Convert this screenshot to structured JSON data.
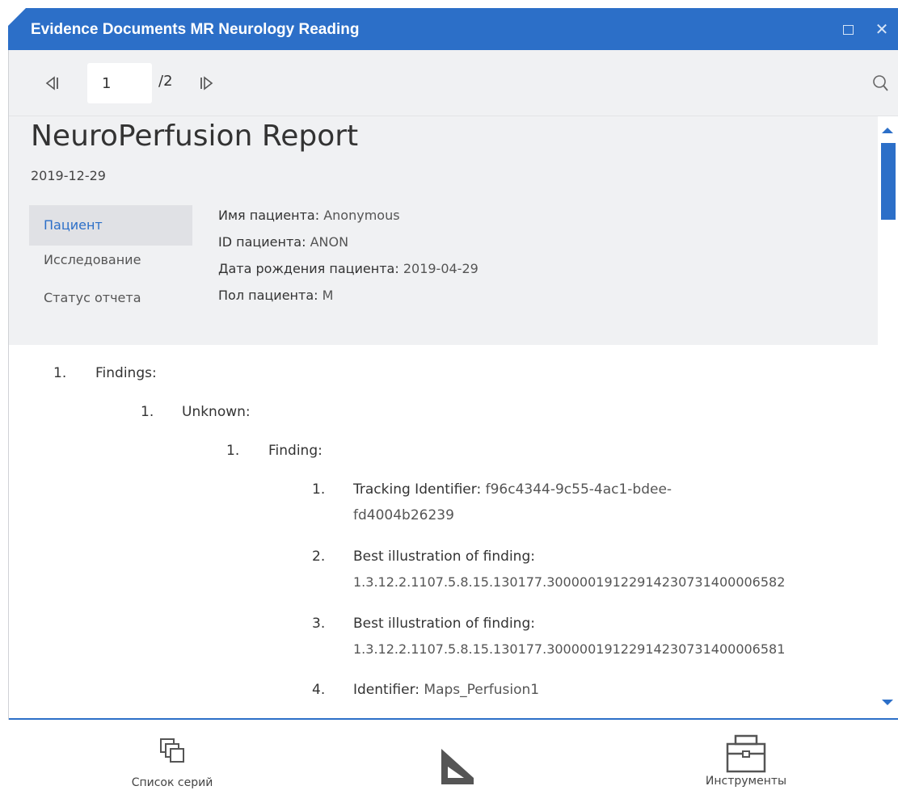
{
  "window": {
    "title": "Evidence Documents MR Neurology Reading"
  },
  "toolbar": {
    "current_page": "1",
    "total_pages": "/2"
  },
  "report": {
    "title": "NeuroPerfusion Report",
    "date": "2019-12-29"
  },
  "side_tabs": [
    {
      "label": "Пациент",
      "active": true
    },
    {
      "label": "Исследование",
      "active": false
    },
    {
      "label": "Статус отчета",
      "active": false
    }
  ],
  "patient": [
    {
      "key": "Имя пациента:",
      "value": "Anonymous"
    },
    {
      "key": "ID пациента:",
      "value": "ANON"
    },
    {
      "key": "Дата рождения пациента:",
      "value": "2019-04-29"
    },
    {
      "key": "Пол пациента:",
      "value": "M"
    }
  ],
  "findings": {
    "l1_num": "1.",
    "l1_label": "Findings:",
    "l2_num": "1.",
    "l2_label": "Unknown:",
    "l3_num": "1.",
    "l3_label": "Finding:",
    "items": [
      {
        "num": "1.",
        "key": "Tracking Identifier:",
        "value_line1": "f96c4344-9c55-4ac1-bdee-",
        "value_line2": "fd4004b26239"
      },
      {
        "num": "2.",
        "key": "Best illustration of finding:",
        "value_line2": "1.3.12.2.1107.5.8.15.130177.30000019122914230731400006582"
      },
      {
        "num": "3.",
        "key": "Best illustration of finding:",
        "value_line2": "1.3.12.2.1107.5.8.15.130177.30000019122914230731400006581"
      },
      {
        "num": "4.",
        "key": "Identifier:",
        "value_line1": "Maps_Perfusion1"
      }
    ]
  },
  "bottom_bar": {
    "series_label": "Список серий",
    "tools_label": "Инструменты"
  },
  "colors": {
    "accent": "#2c6fc8",
    "panel_bg": "#f0f1f3",
    "active_tab_bg": "#e0e1e5"
  },
  "icons": {
    "prev": "skip-back-icon",
    "next": "skip-forward-icon",
    "search": "search-icon",
    "series": "series-list-icon",
    "logo": "app-logo-icon",
    "tools": "toolbox-icon"
  }
}
